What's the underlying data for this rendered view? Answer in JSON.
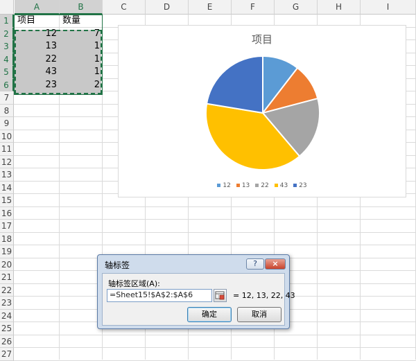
{
  "columns": [
    "A",
    "B",
    "C",
    "D",
    "E",
    "F",
    "G",
    "H",
    "I"
  ],
  "rows": [
    "1",
    "2",
    "3",
    "4",
    "5",
    "6",
    "7",
    "8",
    "9",
    "10",
    "11",
    "12",
    "13",
    "14",
    "15",
    "16",
    "17",
    "18",
    "19",
    "20",
    "21",
    "22",
    "23",
    "24",
    "25",
    "26",
    "27"
  ],
  "table": {
    "header": [
      "项目",
      "数量"
    ],
    "data": [
      [
        "12",
        "7"
      ],
      [
        "13",
        "1"
      ],
      [
        "22",
        "1"
      ],
      [
        "43",
        "1"
      ],
      [
        "23",
        "2"
      ]
    ]
  },
  "chart_data": {
    "type": "pie",
    "title": "项目",
    "categories": [
      "12",
      "13",
      "22",
      "43",
      "23"
    ],
    "values": [
      7,
      7,
      12,
      26,
      15
    ],
    "colors": [
      "#5b9bd5",
      "#ed7d31",
      "#a5a5a5",
      "#ffc000",
      "#4472c4"
    ],
    "legend_position": "bottom"
  },
  "dialog": {
    "title": "轴标签",
    "help_label": "?",
    "close_label": "×",
    "field_label": "轴标签区域(A):",
    "field_value": "=Sheet15!$A$2:$A$6",
    "preview": "= 12, 13, 22, 43",
    "ok_label": "确定",
    "cancel_label": "取消"
  },
  "icons": {
    "collapse": "range-collapse-icon"
  }
}
